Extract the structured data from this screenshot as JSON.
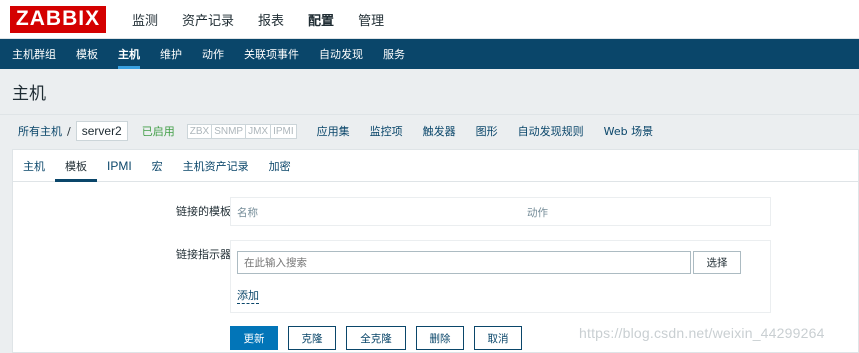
{
  "logo": "ZABBIX",
  "main_menu": [
    "监测",
    "资产记录",
    "报表",
    "配置",
    "管理"
  ],
  "sub_menu": [
    "主机群组",
    "模板",
    "主机",
    "维护",
    "动作",
    "关联项事件",
    "自动发现",
    "服务"
  ],
  "page_title": "主机",
  "breadcrumb": {
    "all_hosts": "所有主机",
    "separator": "/",
    "current_host": "server2",
    "status": "已启用",
    "availability": [
      "ZBX",
      "SNMP",
      "JMX",
      "IPMI"
    ],
    "links": [
      "应用集",
      "监控项",
      "触发器",
      "图形",
      "自动发现规则",
      "Web 场景"
    ]
  },
  "tabs": [
    "主机",
    "模板",
    "IPMI",
    "宏",
    "主机资产记录",
    "加密"
  ],
  "form": {
    "linked_templates_label": "链接的模板",
    "table_headers": {
      "name": "名称",
      "action": "动作"
    },
    "link_indicators_label": "链接指示器",
    "search_placeholder": "在此输入搜索",
    "select_button": "选择",
    "add_link": "添加"
  },
  "buttons": {
    "update": "更新",
    "clone": "克隆",
    "full_clone": "全克隆",
    "delete": "删除",
    "cancel": "取消"
  },
  "watermark": "https://blog.csdn.net/weixin_44299264",
  "colors": {
    "logo_red": "#d40000",
    "submenu_bg": "#0a466a",
    "accent": "#0275b8",
    "enabled_green": "#429e47"
  }
}
